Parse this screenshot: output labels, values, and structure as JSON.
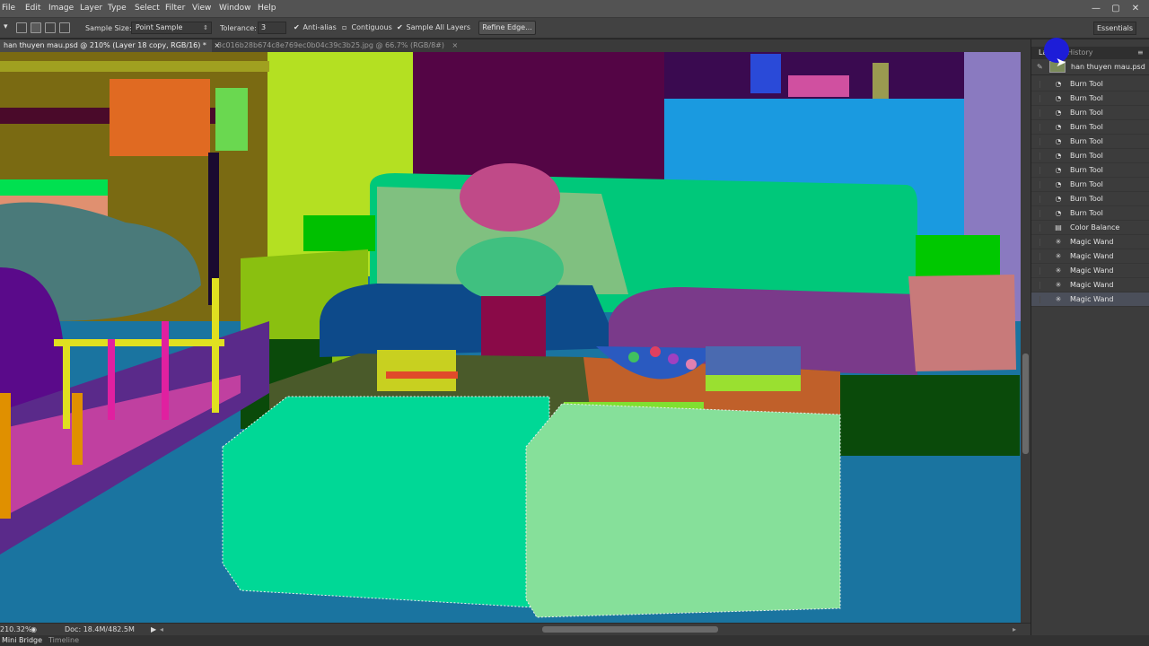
{
  "menu": [
    "File",
    "Edit",
    "Image",
    "Layer",
    "Type",
    "Select",
    "Filter",
    "View",
    "Window",
    "Help"
  ],
  "window_buttons": {
    "minimize": "—",
    "restore": "▢",
    "close": "✕"
  },
  "options": {
    "sample_size_label": "Sample Size:",
    "sample_size_value": "Point Sample",
    "tolerance_label": "Tolerance:",
    "tolerance_value": "3",
    "antialias_label": "Anti-alias",
    "antialias_checked": true,
    "contiguous_label": "Contiguous",
    "contiguous_checked": false,
    "sample_all_layers_label": "Sample All Layers",
    "sample_all_layers_checked": true,
    "refine_edge_label": "Refine Edge...",
    "workspace_label": "Essentials"
  },
  "tabs": [
    {
      "label": "han thuyen mau.psd @ 210% (Layer 18 copy, RGB/16) *",
      "close": "×",
      "active": true
    },
    {
      "label": "3c016b28b674c8e769ec0b04c39c3b25.jpg @ 66.7% (RGB/8#)",
      "close": "×",
      "active": false
    }
  ],
  "status": {
    "zoom": "210.32%",
    "doc": "Doc: 18.4M/482.5M"
  },
  "bottom_tabs": [
    "Mini Bridge",
    "Timeline"
  ],
  "panel": {
    "tabs": [
      "Layers",
      "History"
    ],
    "snapshot_label": "han thuyen mau.psd",
    "history_items": [
      {
        "label": "Burn Tool",
        "icon": "burn-tool-icon",
        "selected": false
      },
      {
        "label": "Burn Tool",
        "icon": "burn-tool-icon",
        "selected": false
      },
      {
        "label": "Burn Tool",
        "icon": "burn-tool-icon",
        "selected": false
      },
      {
        "label": "Burn Tool",
        "icon": "burn-tool-icon",
        "selected": false
      },
      {
        "label": "Burn Tool",
        "icon": "burn-tool-icon",
        "selected": false
      },
      {
        "label": "Burn Tool",
        "icon": "burn-tool-icon",
        "selected": false
      },
      {
        "label": "Burn Tool",
        "icon": "burn-tool-icon",
        "selected": false
      },
      {
        "label": "Burn Tool",
        "icon": "burn-tool-icon",
        "selected": false
      },
      {
        "label": "Burn Tool",
        "icon": "burn-tool-icon",
        "selected": false
      },
      {
        "label": "Burn Tool",
        "icon": "burn-tool-icon",
        "selected": false
      },
      {
        "label": "Color Balance",
        "icon": "adjustment-icon",
        "selected": false
      },
      {
        "label": "Magic Wand",
        "icon": "magic-wand-icon",
        "selected": false
      },
      {
        "label": "Magic Wand",
        "icon": "magic-wand-icon",
        "selected": false
      },
      {
        "label": "Magic Wand",
        "icon": "magic-wand-icon",
        "selected": false
      },
      {
        "label": "Magic Wand",
        "icon": "magic-wand-icon",
        "selected": false
      },
      {
        "label": "Magic Wand",
        "icon": "magic-wand-icon",
        "selected": true
      }
    ]
  },
  "colors": {
    "floor": "#1a74a0",
    "ottoman_left": "#00d896",
    "ottoman_right": "#86e09a",
    "sofa": "#00c87a",
    "wall_lime": "#b4e022",
    "wall_purple": "#540545",
    "cabinet_blue": "#1a9ae0",
    "wall_lavender": "#8a7ac0",
    "shelf_olive": "#7a6a12",
    "cushion_navy": "#0d4a8a",
    "cushion_purple": "#7a3a8a",
    "cushion_pink": "#c87a7a",
    "selected_history": "#4b4f5a",
    "cursor": "#1d1dd8"
  }
}
